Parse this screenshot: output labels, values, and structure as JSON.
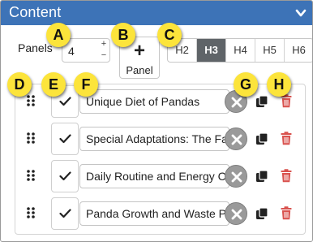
{
  "header": {
    "title": "Content"
  },
  "panels": {
    "label": "Panels",
    "value": "4",
    "increment_label": "+",
    "decrement_label": "−"
  },
  "add_panel": {
    "plus": "+",
    "label": "Panel"
  },
  "heading_levels": {
    "options": [
      "H2",
      "H3",
      "H4",
      "H5",
      "H6"
    ],
    "selected": "H3"
  },
  "panel_list": {
    "items": [
      {
        "title": "Unique Diet of Pandas",
        "checked": true
      },
      {
        "title": "Special Adaptations: The Fal",
        "checked": true
      },
      {
        "title": "Daily Routine and Energy Co",
        "checked": true
      },
      {
        "title": "Panda Growth and Waste Pr",
        "checked": true
      }
    ]
  },
  "callouts": [
    "A",
    "B",
    "C",
    "D",
    "E",
    "F",
    "G",
    "H"
  ],
  "colors": {
    "header": "#3d73b7",
    "active_heading": "#5f6468",
    "callout": "#fce43b",
    "delete": "#d9534f",
    "clear_button": "#9a9a9a"
  },
  "icons": [
    "chevron-down-icon",
    "drag-handle-icon",
    "checkmark-icon",
    "clear-icon",
    "duplicate-icon",
    "trash-icon"
  ]
}
